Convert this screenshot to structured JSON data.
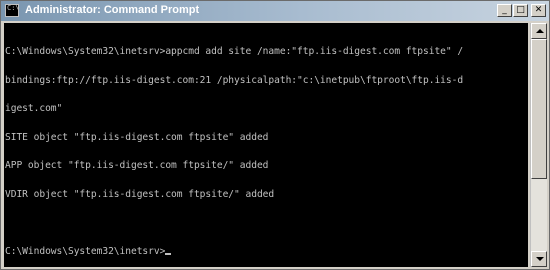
{
  "window": {
    "title": "Administrator: Command Prompt",
    "app_icon": "cmd-icon",
    "controls": {
      "minimize": "_",
      "maximize": "□",
      "close": "✕"
    }
  },
  "console": {
    "lines": [
      "C:\\Windows\\System32\\inetsrv>appcmd add site /name:\"ftp.iis-digest.com ftpsite\" /",
      "bindings:ftp://ftp.iis-digest.com:21 /physicalpath:\"c:\\inetpub\\ftproot\\ftp.iis-d",
      "igest.com\"",
      "SITE object \"ftp.iis-digest.com ftpsite\" added",
      "APP object \"ftp.iis-digest.com ftpsite/\" added",
      "VDIR object \"ftp.iis-digest.com ftpsite/\" added",
      "",
      "C:\\Windows\\System32\\inetsrv>"
    ],
    "colors": {
      "background": "#000000",
      "foreground": "#c0c0c0"
    }
  },
  "scrollbar": {
    "up_icon": "arrow-up-icon",
    "down_icon": "arrow-down-icon"
  }
}
